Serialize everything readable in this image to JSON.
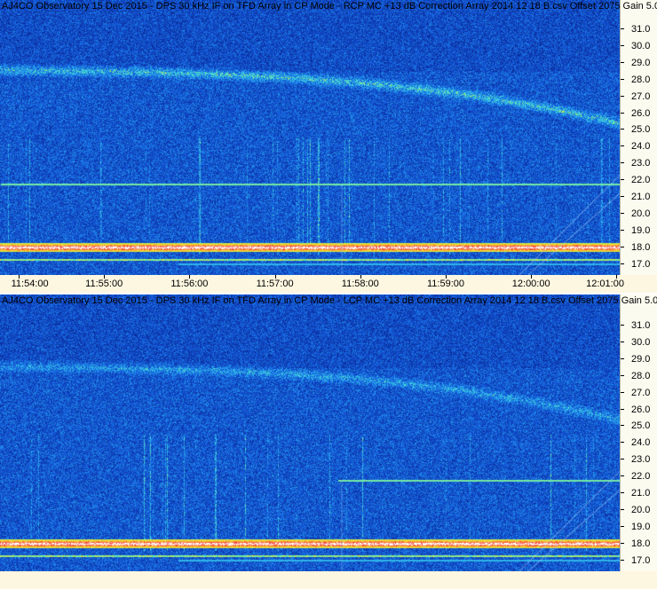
{
  "panels": [
    {
      "title": "AJ4CO Observatory 15 Dec 2015 - DPS 30 kHz IF on TFD Array in CP Mode - RCP  MC +13 dB  Correction Array 2014 12 18 B.csv  Offset 2075  Gain 5.0",
      "polarization": "RCP"
    },
    {
      "title": "AJ4CO Observatory 15 Dec 2015 - DPS 30 kHz IF on TFD Array in CP Mode - LCP  MC +13 dB  Correction Array 2014 12 18 B.csv  Offset 2075  Gain 5.0",
      "polarization": "LCP"
    }
  ],
  "freq_ticks": [
    "31.0",
    "30.0",
    "29.0",
    "28.0",
    "27.0",
    "26.0",
    "25.0",
    "24.0",
    "23.0",
    "22.0",
    "21.0",
    "20.0",
    "19.0",
    "18.0",
    "17.0"
  ],
  "time_ticks": [
    "11:54:00",
    "11:55:00",
    "11:56:00",
    "11:57:00",
    "11:58:00",
    "11:59:00",
    "12:00:00",
    "12:01:00"
  ],
  "colors": {
    "background_blue": "#0a2a8a",
    "axis_panel": "#fbfbf0",
    "time_strip": "#fdf6e0"
  }
}
